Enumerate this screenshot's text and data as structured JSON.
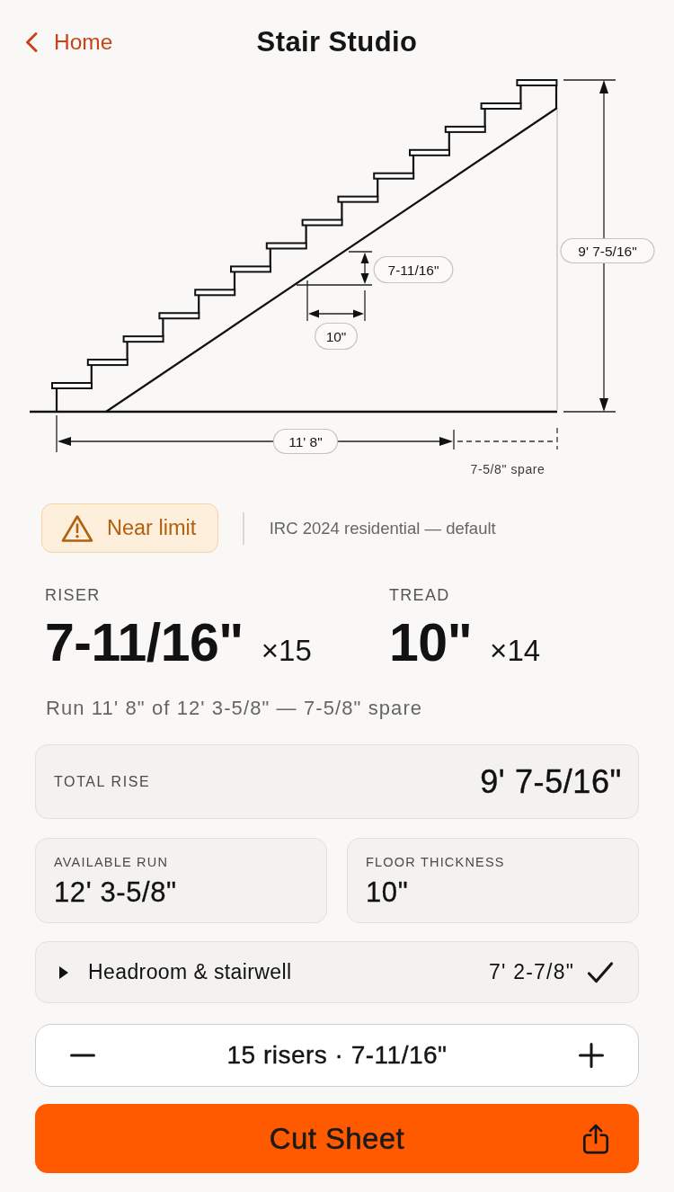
{
  "nav": {
    "back_label": "Home",
    "title": "Stair Studio"
  },
  "diagram": {
    "total_rise_label": "9' 7-5/16\"",
    "run_label": "11' 8\"",
    "riser_label": "7-11/16\"",
    "tread_label": "10\"",
    "spare_label": "7-5/8\" spare"
  },
  "status": {
    "badge": {
      "text": "Near limit",
      "warning": true
    },
    "code": "IRC 2024 residential — default"
  },
  "results": [
    {
      "label": "RISER",
      "value": "7-11/16\"",
      "count": "×15"
    },
    {
      "label": "TREAD",
      "value": "10\"",
      "count": "×14"
    }
  ],
  "run_summary": "Run 11' 8\" of 12' 3-5/8\" — 7-5/8\" spare",
  "inputs": [
    {
      "label": "TOTAL RISE",
      "value": "9' 7-5/16\"",
      "kind": "wide"
    },
    {
      "label": "AVAILABLE RUN",
      "value": "12' 3-5/8\"",
      "kind": "half"
    },
    {
      "label": "FLOOR THICKNESS",
      "value": "10\"",
      "kind": "half"
    }
  ],
  "headroom": {
    "label": "Headroom & stairwell",
    "value": "7' 2-7/8\"",
    "expanded": false,
    "passes": true
  },
  "stepper": {
    "text": "15 risers · 7-11/16\""
  },
  "action": {
    "label": "Cut Sheet"
  }
}
